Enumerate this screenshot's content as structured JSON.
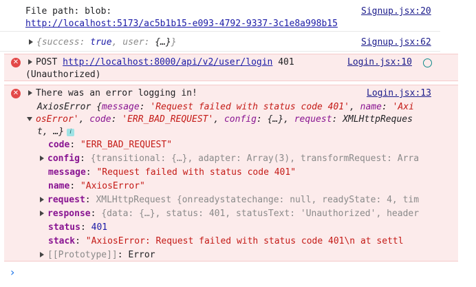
{
  "entries": {
    "e1": {
      "line1": "File path: blob:",
      "url": "http://localhost:5173/ac5b1b15-e093-4792-9337-3c1e8a998b15",
      "source": "Signup.jsx:20"
    },
    "e2": {
      "obj": "{success: true, user: {…}}",
      "k1": "success",
      "v1": "true",
      "k2": "user",
      "v2": "{…}",
      "source": "Signup.jsx:62"
    },
    "e3": {
      "method": "POST",
      "url": "http://localhost:8000/api/v2/user/login",
      "code": "401",
      "status": "(Unauthorized)",
      "source": "Login.jsx:10"
    },
    "e4": {
      "message": "There was an error logging in!",
      "source": "Login.jsx:13",
      "summary1_pre": "AxiosError {",
      "s_message_key": "message",
      "s_message_val": "'Request failed with status code 401'",
      "s_name_key": "name",
      "s_name_val_a": "'Axi",
      "s_name_val_b": "osError'",
      "s_code_key": "code",
      "s_code_val": "'ERR_BAD_REQUEST'",
      "s_config_key": "config",
      "s_config_val": "{…}",
      "s_request_key": "request",
      "s_request_val_a": "XMLHttpReques",
      "s_request_val_b": "t, …}",
      "info_label": "i",
      "props": [
        {
          "key": "code",
          "value": "\"ERR_BAD_REQUEST\"",
          "expandable": false
        },
        {
          "key": "config",
          "value": "{transitional: {…}, adapter: Array(3), transformRequest: Arra",
          "expandable": true
        },
        {
          "key": "message",
          "value": "\"Request failed with status code 401\"",
          "expandable": false
        },
        {
          "key": "name",
          "value": "\"AxiosError\"",
          "expandable": false
        },
        {
          "key": "request",
          "value": "XMLHttpRequest {onreadystatechange: null, readyState: 4, tim",
          "expandable": true
        },
        {
          "key": "response",
          "value": "{data: {…}, status: 401, statusText: 'Unauthorized', header",
          "expandable": true
        },
        {
          "key": "status",
          "value": "401",
          "expandable": false
        },
        {
          "key": "stack",
          "value": "\"AxiosError: Request failed with status code 401\\n    at settl",
          "expandable": false
        },
        {
          "key": "[[Prototype]]",
          "value": "Error",
          "expandable": true
        }
      ]
    }
  },
  "prompt": "›",
  "colors": {
    "error_bg": "#fcebeb",
    "error_icon": "#e34848",
    "link": "#1a1aa6"
  }
}
